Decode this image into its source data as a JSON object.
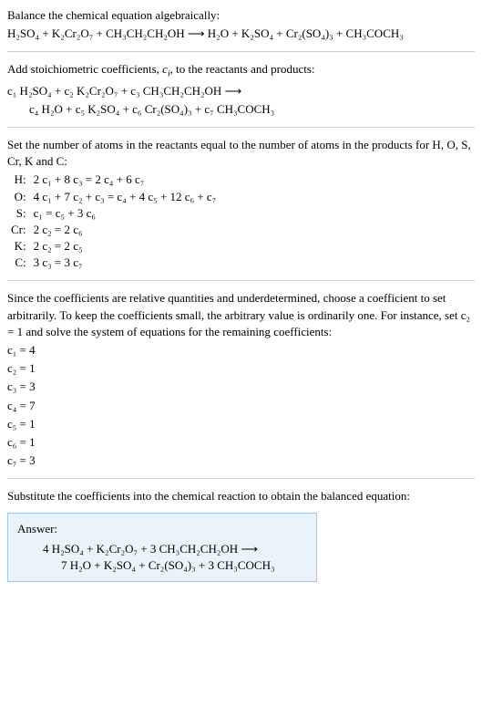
{
  "intro": {
    "title": "Balance the chemical equation algebraically:",
    "equation": "H₂SO₄ + K₂Cr₂O₇ + CH₃CH₂CH₂OH ⟶ H₂O + K₂SO₄ + Cr₂(SO₄)₃ + CH₃COCH₃"
  },
  "stoich": {
    "title": "Add stoichiometric coefficients, cᵢ, to the reactants and products:",
    "line1": "c₁ H₂SO₄ + c₂ K₂Cr₂O₇ + c₃ CH₃CH₂CH₂OH ⟶",
    "line2": "c₄ H₂O + c₅ K₂SO₄ + c₆ Cr₂(SO₄)₃ + c₇ CH₃COCH₃"
  },
  "atoms": {
    "title": "Set the number of atoms in the reactants equal to the number of atoms in the products for H, O, S, Cr, K and C:",
    "rows": [
      {
        "label": "H:",
        "eq": "2 c₁ + 8 c₃ = 2 c₄ + 6 c₇"
      },
      {
        "label": "O:",
        "eq": "4 c₁ + 7 c₂ + c₃ = c₄ + 4 c₅ + 12 c₆ + c₇"
      },
      {
        "label": "S:",
        "eq": "c₁ = c₅ + 3 c₆"
      },
      {
        "label": "Cr:",
        "eq": "2 c₂ = 2 c₆"
      },
      {
        "label": "K:",
        "eq": "2 c₂ = 2 c₅"
      },
      {
        "label": "C:",
        "eq": "3 c₃ = 3 c₇"
      }
    ]
  },
  "solve": {
    "text": "Since the coefficients are relative quantities and underdetermined, choose a coefficient to set arbitrarily. To keep the coefficients small, the arbitrary value is ordinarily one. For instance, set c₂ = 1 and solve the system of equations for the remaining coefficients:",
    "coeffs": [
      "c₁ = 4",
      "c₂ = 1",
      "c₃ = 3",
      "c₄ = 7",
      "c₅ = 1",
      "c₆ = 1",
      "c₇ = 3"
    ]
  },
  "result": {
    "title": "Substitute the coefficients into the chemical reaction to obtain the balanced equation:",
    "answer_label": "Answer:",
    "line1": "4 H₂SO₄ + K₂Cr₂O₇ + 3 CH₃CH₂CH₂OH ⟶",
    "line2": "7 H₂O + K₂SO₄ + Cr₂(SO₄)₃ + 3 CH₃COCH₃"
  }
}
